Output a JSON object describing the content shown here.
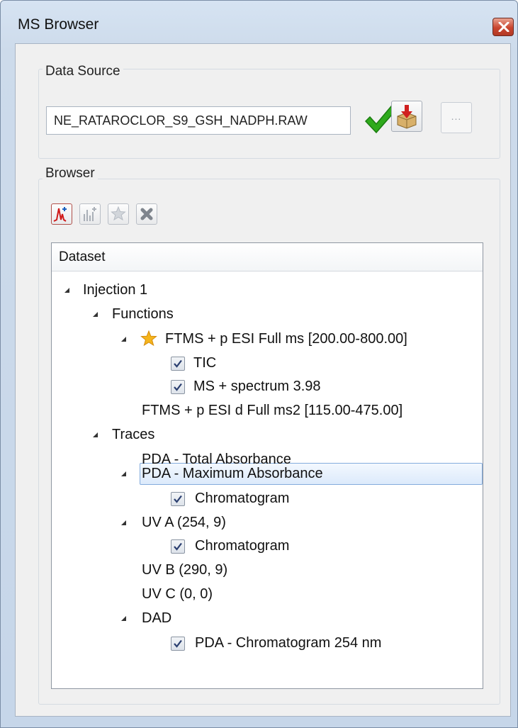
{
  "window": {
    "title": "MS Browser",
    "close_icon": "close-icon"
  },
  "data_source": {
    "group_label": "Data Source",
    "path_value": "NE_RATAROCLOR_S9_GSH_NADPH.RAW",
    "valid_icon": "green-checkmark-icon",
    "import_icon": "import-icon",
    "browse_label": "..."
  },
  "browser": {
    "group_label": "Browser",
    "toolbar": [
      {
        "icon": "chromatogram-icon",
        "enabled": true
      },
      {
        "icon": "spectrum-icon",
        "enabled": false
      },
      {
        "icon": "star-icon",
        "enabled": false
      },
      {
        "icon": "delete-icon",
        "enabled": false
      }
    ],
    "tree": {
      "header": "Dataset",
      "rows": [
        {
          "label": "Injection 1",
          "expanded": true,
          "checkbox": false,
          "star": false
        },
        {
          "label": "Functions",
          "expanded": true,
          "checkbox": false,
          "star": false
        },
        {
          "label": "FTMS + p ESI Full ms [200.00-800.00]",
          "expanded": true,
          "checkbox": false,
          "star": true
        },
        {
          "label": "TIC",
          "expanded": false,
          "checkbox": true,
          "checked": true
        },
        {
          "label": "MS + spectrum 3.98",
          "expanded": false,
          "checkbox": true,
          "checked": true
        },
        {
          "label": "FTMS + p ESI d Full ms2  [115.00-475.00]",
          "expanded": false,
          "checkbox": false
        },
        {
          "label": "Traces",
          "expanded": true,
          "checkbox": false
        },
        {
          "label": "PDA - Total Absorbance",
          "expanded": false,
          "checkbox": false
        },
        {
          "label": "PDA - Maximum Absorbance",
          "expanded": true,
          "checkbox": false,
          "selected": true
        },
        {
          "label": "Chromatogram",
          "expanded": false,
          "checkbox": true,
          "checked": true
        },
        {
          "label": "UV A (254, 9)",
          "expanded": true,
          "checkbox": false
        },
        {
          "label": "Chromatogram",
          "expanded": false,
          "checkbox": true,
          "checked": true
        },
        {
          "label": "UV B (290, 9)",
          "expanded": false,
          "checkbox": false
        },
        {
          "label": "UV C (0, 0)",
          "expanded": false,
          "checkbox": false
        },
        {
          "label": "DAD",
          "expanded": true,
          "checkbox": false
        },
        {
          "label": "PDA - Chromatogram 254 nm",
          "expanded": false,
          "checkbox": true,
          "checked": true
        }
      ]
    }
  },
  "colors": {
    "selection": "#dceafb",
    "check_green": "#2faa1c"
  }
}
